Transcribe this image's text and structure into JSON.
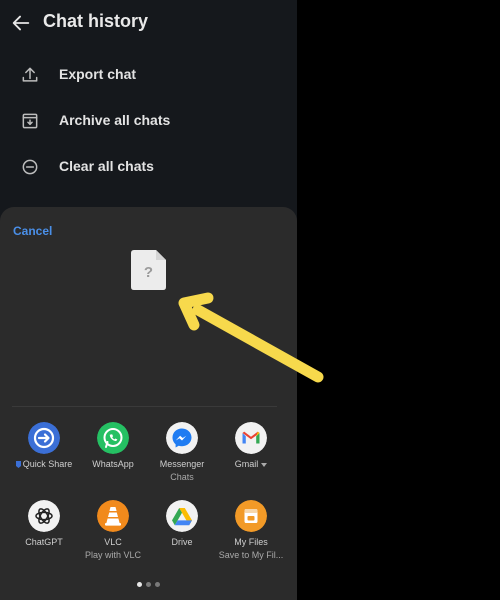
{
  "header": {
    "title": "Chat history"
  },
  "menu": [
    {
      "label": "Export chat",
      "icon": "upload-icon"
    },
    {
      "label": "Archive all chats",
      "icon": "archive-icon"
    },
    {
      "label": "Clear all chats",
      "icon": "minus-circle-icon"
    }
  ],
  "share_sheet": {
    "cancel_label": "Cancel",
    "preview_icon": "unknown-file-icon",
    "preview_glyph": "?",
    "apps": [
      {
        "name": "Quick Share",
        "sub": "",
        "icon": "quick-share-icon"
      },
      {
        "name": "WhatsApp",
        "sub": "",
        "icon": "whatsapp-icon"
      },
      {
        "name": "Messenger",
        "sub": "Chats",
        "icon": "messenger-icon"
      },
      {
        "name": "Gmail",
        "sub": "",
        "icon": "gmail-icon"
      },
      {
        "name": "ChatGPT",
        "sub": "",
        "icon": "chatgpt-icon"
      },
      {
        "name": "VLC",
        "sub": "Play with VLC",
        "icon": "vlc-icon"
      },
      {
        "name": "Drive",
        "sub": "",
        "icon": "google-drive-icon"
      },
      {
        "name": "My Files",
        "sub": "Save to My Fil...",
        "icon": "my-files-icon"
      }
    ],
    "pager": {
      "pages": 3,
      "active": 1
    }
  },
  "colors": {
    "background": "#000000",
    "screen": "#15181c",
    "sheet": "#2b2b2b",
    "accent": "#4a8fe8",
    "arrow": "#f7d94c"
  }
}
